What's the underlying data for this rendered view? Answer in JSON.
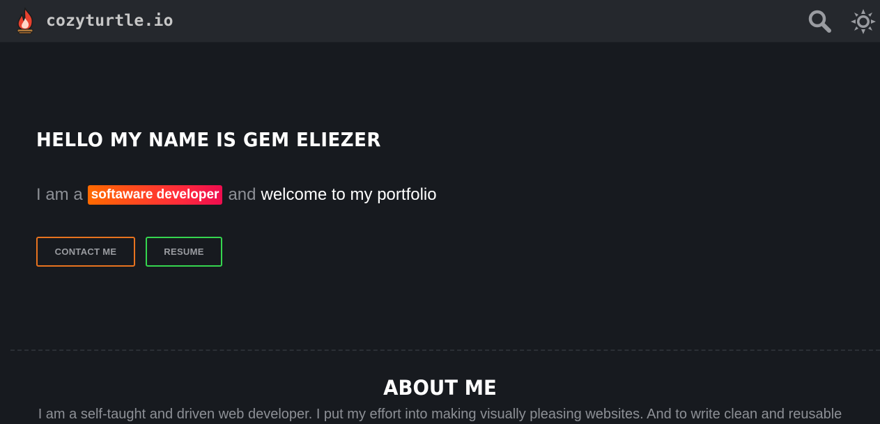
{
  "header": {
    "brand_name": "cozyturtle.io",
    "logo_icon": "campfire-icon",
    "search_icon": "search-icon",
    "theme_icon": "sun-icon"
  },
  "hero": {
    "title": "HELLO MY NAME IS GEM ELIEZER",
    "sub_prefix": "I am a",
    "sub_highlight": "softaware developer",
    "sub_and": "and",
    "sub_suffix": "welcome to my portfolio",
    "contact_label": "CONTACT ME",
    "resume_label": "RESUME"
  },
  "about": {
    "title": "ABOUT ME",
    "text": "I am a self-taught and driven web developer. I put my effort into making visually pleasing websites. And to write clean and reusable"
  },
  "colors": {
    "background": "#171a1f",
    "header": "#25282d",
    "contact_border": "#e8731f",
    "resume_border": "#35d64f",
    "highlight_start": "#ff6a00",
    "highlight_end": "#ee0d4f"
  }
}
